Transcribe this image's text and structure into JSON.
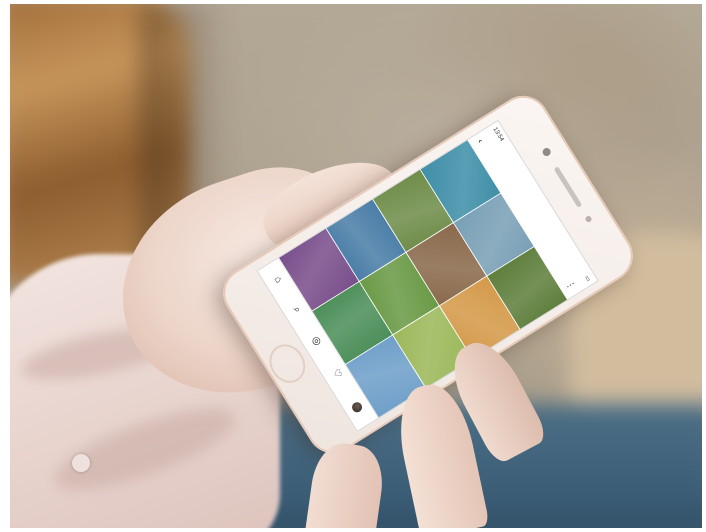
{
  "scene": {
    "description_free": true,
    "background_color": "#ffffff",
    "colors": {
      "wood": "#a06c38",
      "jeans": "#3c5f78",
      "sleeve": "#f3e6e2",
      "skin": "#f0d9cc",
      "phone_body": "#fbf6f3"
    }
  },
  "phone": {
    "status_bar": {
      "time": "13:54",
      "battery": ""
    },
    "header": {
      "title": "",
      "back_icon": "back-arrow-icon",
      "menu_icon": "more-icon"
    },
    "grid_tiles": [
      {
        "name": "tile-island",
        "color": "#3f8fa8"
      },
      {
        "name": "tile-coast",
        "color": "#7aa0b6"
      },
      {
        "name": "tile-trees",
        "color": "#5f7f3d"
      },
      {
        "name": "tile-forest",
        "color": "#6f8d4a"
      },
      {
        "name": "tile-gate",
        "color": "#8a6a4c"
      },
      {
        "name": "tile-sunset",
        "color": "#d49a4a"
      },
      {
        "name": "tile-bay",
        "color": "#4b7ea7"
      },
      {
        "name": "tile-garden",
        "color": "#6a9a46"
      },
      {
        "name": "tile-meadow",
        "color": "#9cb85a"
      },
      {
        "name": "tile-purple",
        "color": "#7a4f8c"
      },
      {
        "name": "tile-heart",
        "color": "#4d8f5a"
      },
      {
        "name": "tile-sky",
        "color": "#6f9fc9"
      }
    ],
    "tabbar": [
      {
        "name": "home-icon",
        "glyph": "⌂"
      },
      {
        "name": "search-icon",
        "glyph": "⌕"
      },
      {
        "name": "camera-icon",
        "glyph": "◎"
      },
      {
        "name": "heart-icon",
        "glyph": "♡"
      },
      {
        "name": "avatar",
        "glyph": ""
      }
    ]
  }
}
